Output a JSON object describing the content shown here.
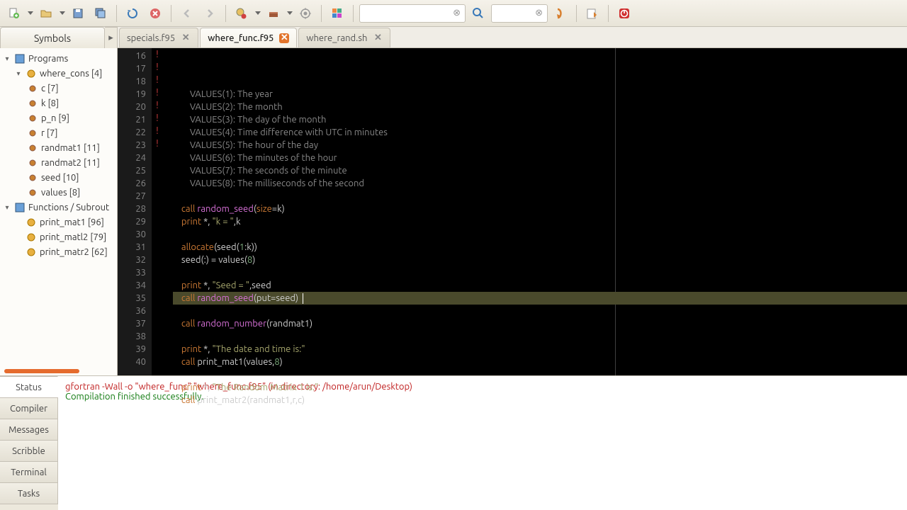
{
  "toolbar": {
    "search1_placeholder": "",
    "search2_placeholder": ""
  },
  "symbols_label": "Symbols",
  "tree": {
    "programs": "Programs",
    "where_cons": "where_cons [4]",
    "vars": [
      {
        "label": "c [7]"
      },
      {
        "label": "k [8]"
      },
      {
        "label": "p_n [9]"
      },
      {
        "label": "r [7]"
      },
      {
        "label": "randmat1 [11]"
      },
      {
        "label": "randmat2 [11]"
      },
      {
        "label": "seed [10]"
      },
      {
        "label": "values [8]"
      }
    ],
    "funcs_label": "Functions / Subrout",
    "funcs": [
      {
        "label": "print_mat1 [96]"
      },
      {
        "label": "print_matl2 [79]"
      },
      {
        "label": "print_matr2 [62]"
      }
    ]
  },
  "tabs": [
    {
      "name": "specials.f95",
      "active": false
    },
    {
      "name": "where_func.f95",
      "active": true
    },
    {
      "name": "where_rand.sh",
      "active": false
    }
  ],
  "editor": {
    "first_line": 16,
    "highlight_line": 32,
    "lines": [
      {
        "n": 16,
        "marked": true,
        "segs": [
          {
            "c": "tk-com",
            "t": "    VALUES(1): The year"
          }
        ]
      },
      {
        "n": 17,
        "marked": true,
        "segs": [
          {
            "c": "tk-com",
            "t": "    VALUES(2): The month"
          }
        ]
      },
      {
        "n": 18,
        "marked": true,
        "segs": [
          {
            "c": "tk-com",
            "t": "    VALUES(3): The day of the month"
          }
        ]
      },
      {
        "n": 19,
        "marked": true,
        "segs": [
          {
            "c": "tk-com",
            "t": "    VALUES(4): Time difference with UTC in minutes"
          }
        ]
      },
      {
        "n": 20,
        "marked": true,
        "segs": [
          {
            "c": "tk-com",
            "t": "    VALUES(5): The hour of the day"
          }
        ]
      },
      {
        "n": 21,
        "marked": true,
        "segs": [
          {
            "c": "tk-com",
            "t": "    VALUES(6): The minutes of the hour"
          }
        ]
      },
      {
        "n": 22,
        "marked": true,
        "segs": [
          {
            "c": "tk-com",
            "t": "    VALUES(7): The seconds of the minute"
          }
        ]
      },
      {
        "n": 23,
        "marked": true,
        "segs": [
          {
            "c": "tk-com",
            "t": "    VALUES(8): The milliseconds of the second"
          }
        ]
      },
      {
        "n": 24,
        "marked": false,
        "segs": []
      },
      {
        "n": 25,
        "marked": false,
        "segs": [
          {
            "c": "tk-kw",
            "t": "call "
          },
          {
            "c": "tk-call",
            "t": "random_seed"
          },
          {
            "c": "tk-ident",
            "t": "("
          },
          {
            "c": "tk-kw",
            "t": "size"
          },
          {
            "c": "tk-ident",
            "t": "=k)"
          }
        ]
      },
      {
        "n": 26,
        "marked": false,
        "segs": [
          {
            "c": "tk-kw",
            "t": "print"
          },
          {
            "c": "tk-ident",
            "t": " *, "
          },
          {
            "c": "tk-str",
            "t": "\"k = \""
          },
          {
            "c": "tk-ident",
            "t": ",k"
          }
        ]
      },
      {
        "n": 27,
        "marked": false,
        "segs": []
      },
      {
        "n": 28,
        "marked": false,
        "segs": [
          {
            "c": "tk-kw",
            "t": "allocate"
          },
          {
            "c": "tk-ident",
            "t": "(seed("
          },
          {
            "c": "tk-num",
            "t": "1"
          },
          {
            "c": "tk-ident",
            "t": ":k))"
          }
        ]
      },
      {
        "n": 29,
        "marked": false,
        "segs": [
          {
            "c": "tk-ident",
            "t": "seed(:) = values("
          },
          {
            "c": "tk-num",
            "t": "8"
          },
          {
            "c": "tk-ident",
            "t": ")"
          }
        ]
      },
      {
        "n": 30,
        "marked": false,
        "segs": []
      },
      {
        "n": 31,
        "marked": false,
        "segs": [
          {
            "c": "tk-kw",
            "t": "print"
          },
          {
            "c": "tk-ident",
            "t": " *, "
          },
          {
            "c": "tk-str",
            "t": "\"Seed = \""
          },
          {
            "c": "tk-ident",
            "t": ",seed"
          }
        ]
      },
      {
        "n": 32,
        "marked": false,
        "segs": [
          {
            "c": "tk-kw",
            "t": "call "
          },
          {
            "c": "tk-call",
            "t": "random_seed"
          },
          {
            "c": "tk-ident",
            "t": "(put=seed)"
          }
        ],
        "cursor": true
      },
      {
        "n": 33,
        "marked": false,
        "segs": []
      },
      {
        "n": 34,
        "marked": false,
        "segs": [
          {
            "c": "tk-kw",
            "t": "call "
          },
          {
            "c": "tk-call",
            "t": "random_number"
          },
          {
            "c": "tk-ident",
            "t": "(randmat1)"
          }
        ]
      },
      {
        "n": 35,
        "marked": false,
        "segs": []
      },
      {
        "n": 36,
        "marked": false,
        "segs": [
          {
            "c": "tk-kw",
            "t": "print"
          },
          {
            "c": "tk-ident",
            "t": " *, "
          },
          {
            "c": "tk-str",
            "t": "\"The date and time is:\""
          }
        ]
      },
      {
        "n": 37,
        "marked": false,
        "segs": [
          {
            "c": "tk-kw",
            "t": "call"
          },
          {
            "c": "tk-ident",
            "t": " print_mat1(values,"
          },
          {
            "c": "tk-num",
            "t": "8"
          },
          {
            "c": "tk-ident",
            "t": ")"
          }
        ]
      },
      {
        "n": 38,
        "marked": false,
        "segs": []
      },
      {
        "n": 39,
        "marked": false,
        "segs": [
          {
            "c": "tk-kw",
            "t": "print"
          },
          {
            "c": "tk-ident",
            "t": " *, "
          },
          {
            "c": "tk-str",
            "t": "\"The Random Matrix 1 is:\""
          }
        ]
      },
      {
        "n": 40,
        "marked": false,
        "segs": [
          {
            "c": "tk-kw",
            "t": "call"
          },
          {
            "c": "tk-ident",
            "t": " print_matr2(randmat1,r,c)"
          }
        ]
      }
    ]
  },
  "bottom_tabs": [
    "Status",
    "Compiler",
    "Messages",
    "Scribble",
    "Terminal",
    "Tasks"
  ],
  "bottom_active": "Status",
  "console": {
    "cmd": "gfortran -Wall -o \"where_func\" \"where_func.f95\" (in directory: /home/arun/Desktop)",
    "result": "Compilation finished successfully."
  }
}
